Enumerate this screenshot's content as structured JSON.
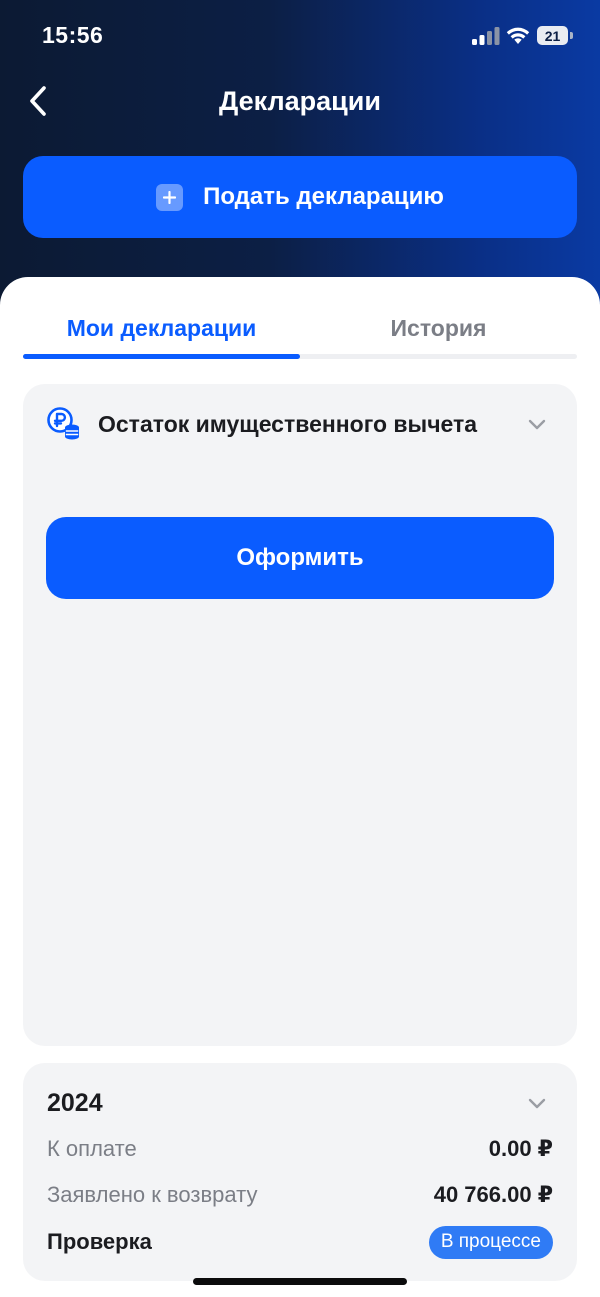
{
  "status_bar": {
    "time": "15:56",
    "battery": "21"
  },
  "header": {
    "title": "Декларации",
    "submit_label": "Подать декларацию",
    "back_icon": "chevron-left-icon"
  },
  "tabs": [
    {
      "label": "Мои декларации",
      "active": true
    },
    {
      "label": "История",
      "active": false
    }
  ],
  "deduction_card": {
    "icon": "ruble-coins-icon",
    "title": "Остаток имущественного вычета",
    "apply_label": "Оформить"
  },
  "declaration_card": {
    "year": "2024",
    "rows": [
      {
        "label": "К оплате",
        "value": "0.00 ₽"
      },
      {
        "label": "Заявлено к возврату",
        "value": "40 766.00 ₽"
      },
      {
        "label": "Проверка",
        "value": "В процессе"
      }
    ]
  },
  "colors": {
    "accent": "#0a5cff",
    "header_dark": "#0c1a33",
    "header_blue": "#0a3aa3",
    "card_bg": "#f3f4f6",
    "badge": "#2f7bf5"
  }
}
